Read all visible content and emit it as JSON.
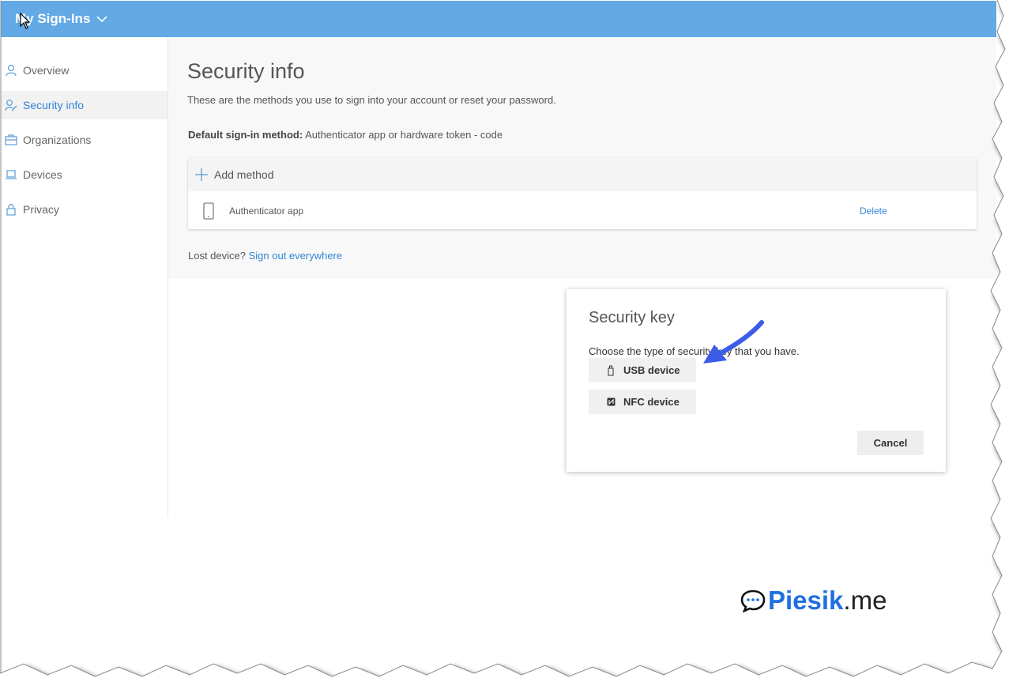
{
  "header": {
    "title": "My Sign-Ins"
  },
  "sidebar": {
    "items": [
      {
        "label": "Overview",
        "icon": "person-icon"
      },
      {
        "label": "Security info",
        "icon": "person-edit-icon",
        "active": true
      },
      {
        "label": "Organizations",
        "icon": "briefcase-icon"
      },
      {
        "label": "Devices",
        "icon": "laptop-icon"
      },
      {
        "label": "Privacy",
        "icon": "lock-icon"
      }
    ]
  },
  "main": {
    "title": "Security info",
    "description": "These are the methods you use to sign into your account or reset your password.",
    "default_method_label": "Default sign-in method:",
    "default_method_value": " Authenticator app or hardware token - code",
    "add_method_label": "Add method",
    "methods": [
      {
        "name": "Authenticator app",
        "action": "Delete",
        "icon": "phone-icon"
      }
    ],
    "lost_device_text": "Lost device? ",
    "sign_out_link": "Sign out everywhere"
  },
  "dialog": {
    "title": "Security key",
    "text": "Choose the type of security key that you have.",
    "usb_label": "USB device",
    "nfc_label": "NFC device",
    "cancel_label": "Cancel"
  },
  "watermark": {
    "part1": "Piesik",
    "part2": ".me"
  },
  "colors": {
    "header": "#62a9e6",
    "accent": "#2f86d6",
    "arrow": "#3c5ce8",
    "logo_blue": "#1f6fe0"
  }
}
